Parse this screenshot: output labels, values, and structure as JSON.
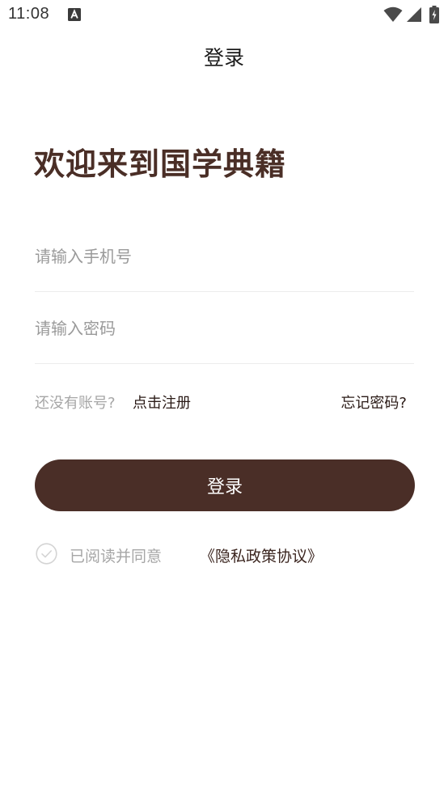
{
  "status_bar": {
    "time": "11:08",
    "icons": [
      "notification-a-icon",
      "wifi-icon",
      "signal-icon",
      "battery-charging-icon"
    ]
  },
  "header": {
    "title": "登录"
  },
  "welcome": "欢迎来到国学典籍",
  "form": {
    "phone": {
      "placeholder": "请输入手机号",
      "value": ""
    },
    "password": {
      "placeholder": "请输入密码",
      "value": ""
    }
  },
  "links": {
    "no_account": "还没有账号?",
    "register": "点击注册",
    "forgot": "忘记密码?"
  },
  "login_button": "登录",
  "agreement": {
    "checked": false,
    "text": "已阅读并同意",
    "link": "《隐私政策协议》"
  },
  "colors": {
    "brand": "#4a2e27",
    "placeholder": "#9a9a9a",
    "muted_text": "#a6a6a6",
    "divider": "#ececec"
  }
}
